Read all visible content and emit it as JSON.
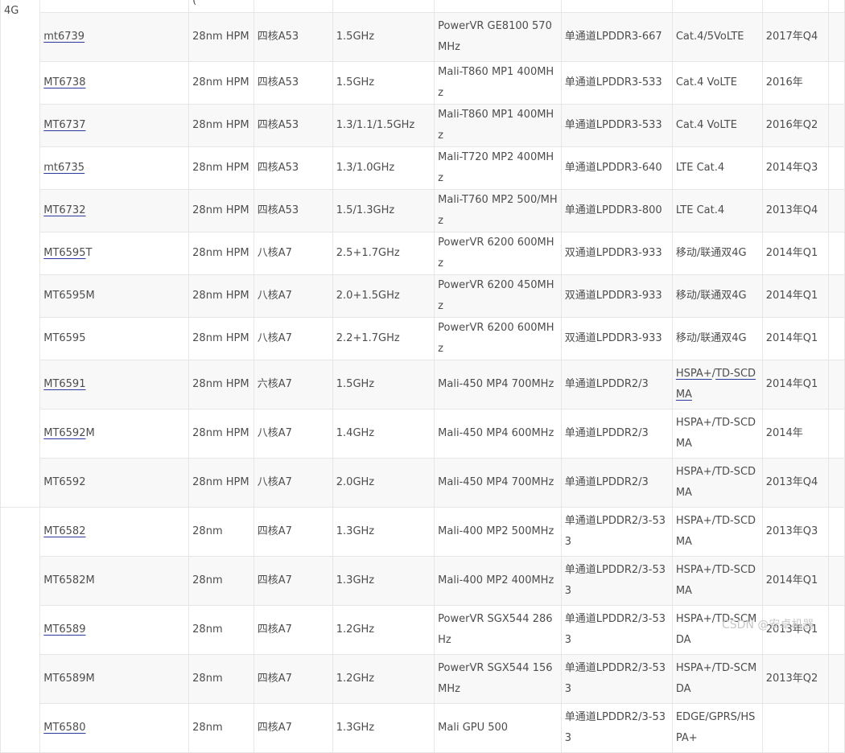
{
  "groups": [
    {
      "label": "4G"
    },
    {
      "label": ""
    }
  ],
  "top_partial": {
    "process": "("
  },
  "rows": [
    {
      "model_link": "mt6739",
      "model_rest": "",
      "process": "28nm HPM",
      "cpu": "四核A53",
      "freq": "1.5GHz",
      "gpu": "PowerVR GE8100 570MHz",
      "memory": "单通道LPDDR3-667",
      "network": "Cat.4/5VoLTE",
      "date": "2017年Q4"
    },
    {
      "model_link": "MT6738",
      "model_rest": "",
      "process": "28nm HPM",
      "cpu": "四核A53",
      "freq": "1.5GHz",
      "gpu": "Mali-T860 MP1 400MHz",
      "memory": "单通道LPDDR3-533",
      "network": "Cat.4 VoLTE",
      "date": "2016年"
    },
    {
      "model_link": "MT6737",
      "model_rest": "",
      "process": "28nm HPM",
      "cpu": "四核A53",
      "freq": "1.3/1.1/1.5GHz",
      "gpu": "Mali-T860 MP1 400MHz",
      "memory": "单通道LPDDR3-533",
      "network": "Cat.4 VoLTE",
      "date": "2016年Q2"
    },
    {
      "model_link": "mt6735",
      "model_rest": "",
      "process": "28nm HPM",
      "cpu": "四核A53",
      "freq": "1.3/1.0GHz",
      "gpu": "Mali-T720 MP2 400MHz",
      "memory": "单通道LPDDR3-640",
      "network": "LTE Cat.4",
      "date": "2014年Q3"
    },
    {
      "model_link": "MT6732",
      "model_rest": "",
      "process": "28nm HPM",
      "cpu": "四核A53",
      "freq": "1.5/1.3GHz",
      "gpu": "Mali-T760 MP2 500/MHz",
      "memory": "单通道LPDDR3-800",
      "network": "LTE Cat.4",
      "date": "2013年Q4"
    },
    {
      "model_link": "MT6595",
      "model_rest": "T",
      "process": "28nm HPM",
      "cpu": "八核A7",
      "freq": "2.5+1.7GHz",
      "gpu": "PowerVR 6200 600MHz",
      "memory": "双通道LPDDR3-933",
      "network": "移动/联通双4G",
      "date": "2014年Q1"
    },
    {
      "model_link": "",
      "model_rest": "MT6595M",
      "process": "28nm HPM",
      "cpu": "八核A7",
      "freq": "2.0+1.5GHz",
      "gpu": "PowerVR 6200 450MHz",
      "memory": "双通道LPDDR3-933",
      "network": "移动/联通双4G",
      "date": "2014年Q1"
    },
    {
      "model_link": "",
      "model_rest": "MT6595",
      "process": "28nm HPM",
      "cpu": "八核A7",
      "freq": "2.2+1.7GHz",
      "gpu": "PowerVR 6200 600MHz",
      "memory": "双通道LPDDR3-933",
      "network": "移动/联通双4G",
      "date": "2014年Q1"
    },
    {
      "model_link": "MT6591",
      "model_rest": "",
      "process": "28nm HPM",
      "cpu": "六核A7",
      "freq": "1.5GHz",
      "gpu": "Mali-450 MP4 700MHz",
      "memory": "单通道LPDDR2/3",
      "network_links": [
        "HSPA+",
        "TD-SCDMA"
      ],
      "network_sep": "/",
      "date": "2014年Q1"
    },
    {
      "model_link": "MT6592",
      "model_rest": "M",
      "process": "28nm HPM",
      "cpu": "八核A7",
      "freq": "1.4GHz",
      "gpu": "Mali-450 MP4 600MHz",
      "memory": "单通道LPDDR2/3",
      "network": "HSPA+/TD-SCDMA",
      "date": "2014年"
    },
    {
      "model_link": "",
      "model_rest": "MT6592",
      "process": "28nm HPM",
      "cpu": "八核A7",
      "freq": "2.0GHz",
      "gpu": "Mali-450 MP4 700MHz",
      "memory": "单通道LPDDR2/3",
      "network": "HSPA+/TD-SCDMA",
      "date": "2013年Q4"
    },
    {
      "model_link": "MT6582",
      "model_rest": "",
      "process": "28nm",
      "cpu": "四核A7",
      "freq": "1.3GHz",
      "gpu": "Mali-400 MP2 500MHz",
      "memory": "单通道LPDDR2/3-533",
      "network": "HSPA+/TD-SCDMA",
      "date": "2013年Q3"
    },
    {
      "model_link": "",
      "model_rest": "MT6582M",
      "process": "28nm",
      "cpu": "四核A7",
      "freq": "1.3GHz",
      "gpu": "Mali-400 MP2 400MHz",
      "memory": "单通道LPDDR2/3-533",
      "network": "HSPA+/TD-SCDMA",
      "date": "2014年Q1"
    },
    {
      "model_link": "MT6589",
      "model_rest": "",
      "process": "28nm",
      "cpu": "四核A7",
      "freq": "1.2GHz",
      "gpu": "PowerVR SGX544 286Hz",
      "memory": "单通道LPDDR2/3-533",
      "network": "HSPA+/TD-SCMDA",
      "date": "2013年Q1"
    },
    {
      "model_link": "",
      "model_rest": "MT6589M",
      "process": "28nm",
      "cpu": "四核A7",
      "freq": "1.2GHz",
      "gpu": "PowerVR SGX544 156MHz",
      "memory": "单通道LPDDR2/3-533",
      "network": "HSPA+/TD-SCMDA",
      "date": "2013年Q2"
    },
    {
      "model_link": "MT6580",
      "model_rest": "",
      "process": "28nm",
      "cpu": "四核A7",
      "freq": "1.3GHz",
      "gpu": "Mali GPU 500",
      "memory": "单通道LPDDR2/3-533",
      "network": "EDGE/GPRS/HSPA+",
      "date": ""
    }
  ],
  "watermark": "CSDN @安卓机器"
}
